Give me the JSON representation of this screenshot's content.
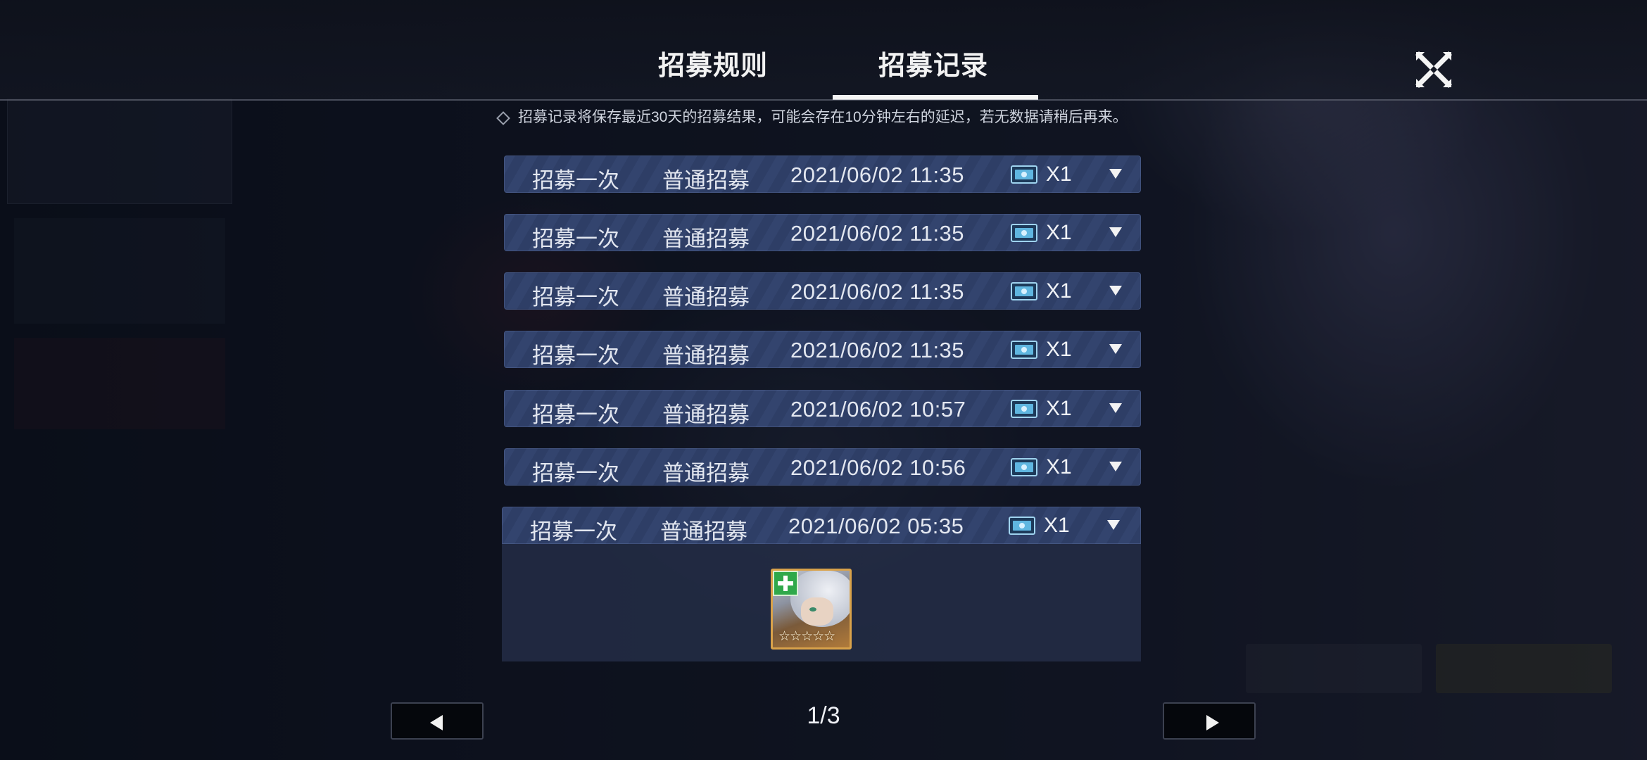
{
  "tabs": {
    "rules": "招募规则",
    "records": "招募记录",
    "active": "records"
  },
  "notice": "招募记录将保存最近30天的招募结果，可能会存在10分钟左右的延迟，若无数据请稍后再来。",
  "records": [
    {
      "type": "招募一次",
      "pool": "普通招募",
      "time": "2021/06/02 11:35",
      "qty": "X1",
      "expanded": false
    },
    {
      "type": "招募一次",
      "pool": "普通招募",
      "time": "2021/06/02 11:35",
      "qty": "X1",
      "expanded": false
    },
    {
      "type": "招募一次",
      "pool": "普通招募",
      "time": "2021/06/02 11:35",
      "qty": "X1",
      "expanded": false
    },
    {
      "type": "招募一次",
      "pool": "普通招募",
      "time": "2021/06/02 11:35",
      "qty": "X1",
      "expanded": false
    },
    {
      "type": "招募一次",
      "pool": "普通招募",
      "time": "2021/06/02 10:57",
      "qty": "X1",
      "expanded": false
    },
    {
      "type": "招募一次",
      "pool": "普通招募",
      "time": "2021/06/02 10:56",
      "qty": "X1",
      "expanded": false
    },
    {
      "type": "招募一次",
      "pool": "普通招募",
      "time": "2021/06/02 05:35",
      "qty": "X1",
      "expanded": true
    }
  ],
  "expanded_result": {
    "character_class": "healer",
    "stars": 5,
    "stars_text": "☆☆☆☆☆"
  },
  "pagination": {
    "text": "1/3",
    "current": 1,
    "total": 3
  },
  "icons": {
    "close": "close-icon",
    "ticket": "recruit-ticket-icon",
    "expand": "chevron-down-icon",
    "prev": "prev-page-icon",
    "next": "next-page-icon"
  },
  "colors": {
    "row_bg": "#33446e",
    "card_border": "#d9a24a",
    "healer_badge": "#2fa84a"
  }
}
